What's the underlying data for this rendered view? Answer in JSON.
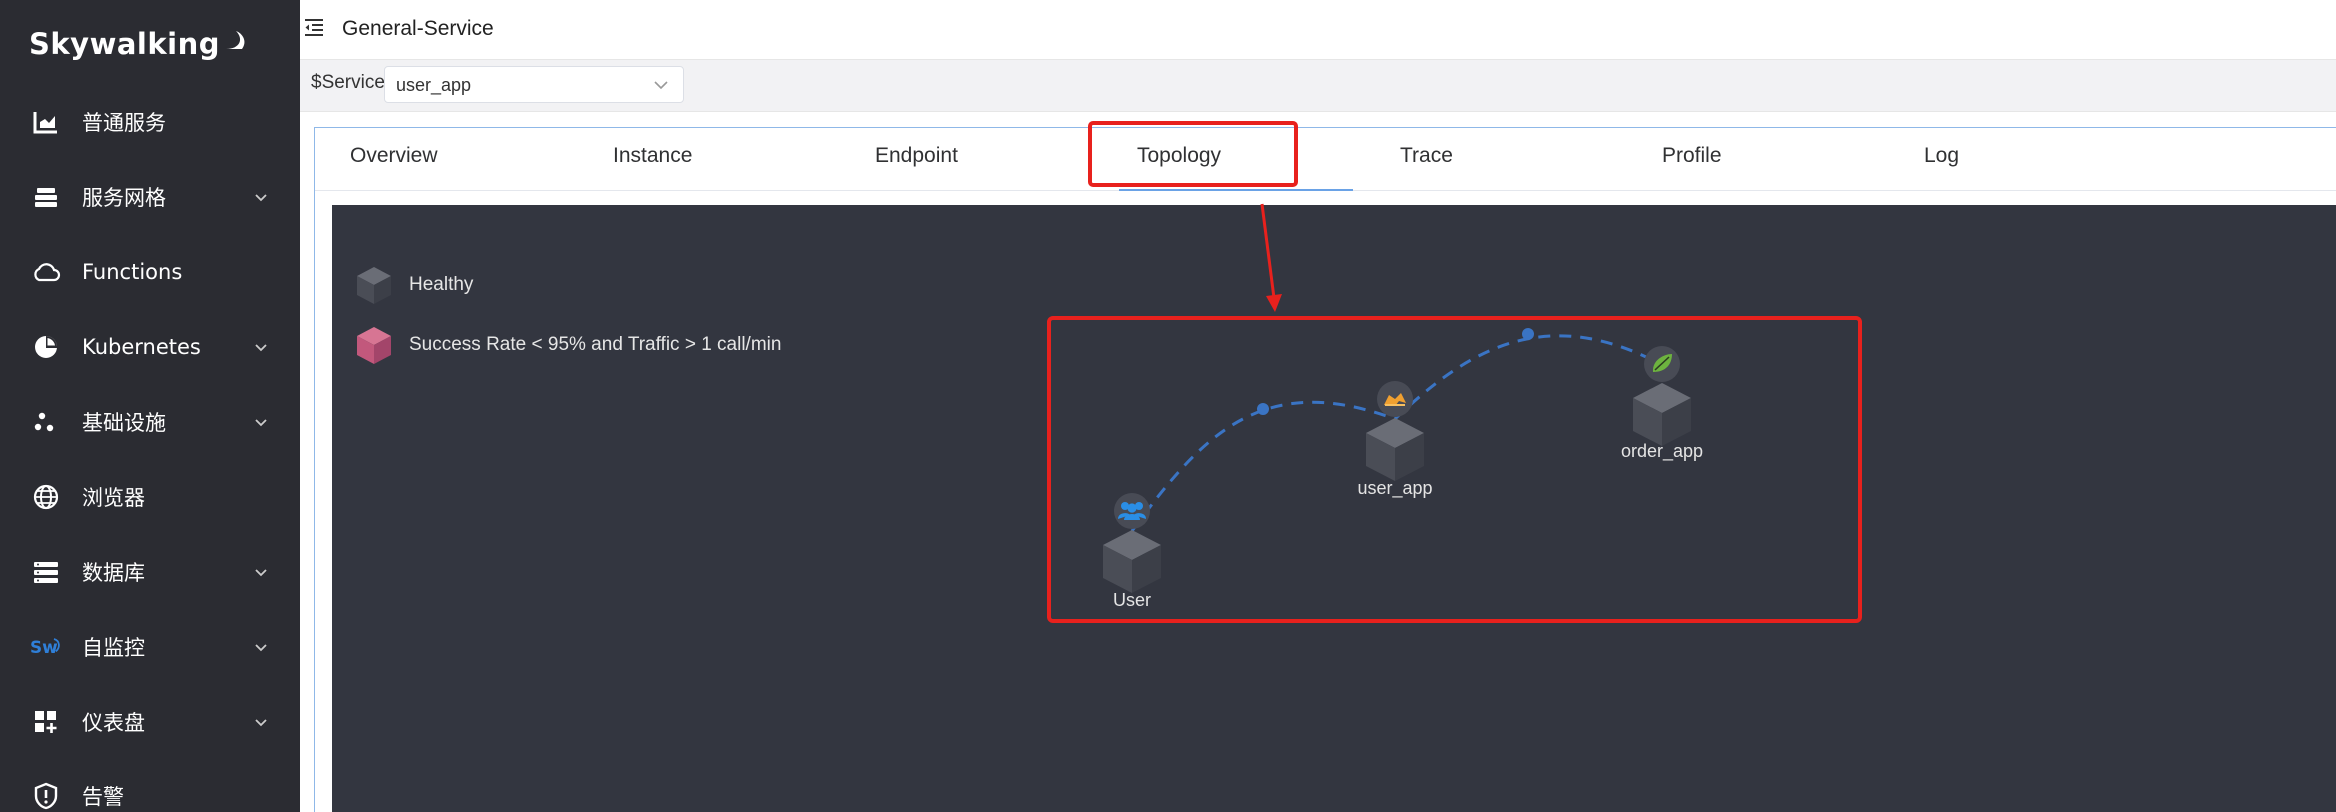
{
  "sidebar": {
    "logo_text": "Skywalking",
    "items": [
      {
        "label": "普通服务",
        "icon": "bar-chart-icon",
        "has_submenu": false
      },
      {
        "label": "服务网格",
        "icon": "layers-icon",
        "has_submenu": true
      },
      {
        "label": "Functions",
        "icon": "cloud-icon",
        "has_submenu": false
      },
      {
        "label": "Kubernetes",
        "icon": "pie-chart-icon",
        "has_submenu": true
      },
      {
        "label": "基础设施",
        "icon": "nodes-icon",
        "has_submenu": true
      },
      {
        "label": "浏览器",
        "icon": "globe-icon",
        "has_submenu": false
      },
      {
        "label": "数据库",
        "icon": "database-list-icon",
        "has_submenu": true
      },
      {
        "label": "自监控",
        "icon": "sw-icon",
        "has_submenu": true
      },
      {
        "label": "仪表盘",
        "icon": "dashboard-add-icon",
        "has_submenu": true
      },
      {
        "label": "告警",
        "icon": "alarm-shield-icon",
        "has_submenu": false
      }
    ]
  },
  "header": {
    "title": "General-Service"
  },
  "filter": {
    "service_label": "$Service",
    "service_value": "user_app"
  },
  "tabs": [
    {
      "label": "Overview"
    },
    {
      "label": "Instance"
    },
    {
      "label": "Endpoint"
    },
    {
      "label": "Topology",
      "active": true
    },
    {
      "label": "Trace"
    },
    {
      "label": "Profile"
    },
    {
      "label": "Log"
    }
  ],
  "topology": {
    "legend": [
      {
        "label": "Healthy",
        "color": "#4a4d56"
      },
      {
        "label": "Success Rate < 95% and Traffic > 1 call/min",
        "color": "#c2587c"
      }
    ],
    "nodes": [
      {
        "name": "User",
        "icon": "users-icon"
      },
      {
        "name": "user_app",
        "icon": "tomcat-icon"
      },
      {
        "name": "order_app",
        "icon": "spring-leaf-icon"
      }
    ],
    "edges": [
      {
        "from": "User",
        "to": "user_app"
      },
      {
        "from": "user_app",
        "to": "order_app"
      }
    ]
  },
  "colors": {
    "sidebar_bg": "#2b2c32",
    "topology_bg": "#333640",
    "edge": "#3a74c4",
    "annotation": "#e8211d",
    "tab_active_underline": "#6aa2e6"
  }
}
